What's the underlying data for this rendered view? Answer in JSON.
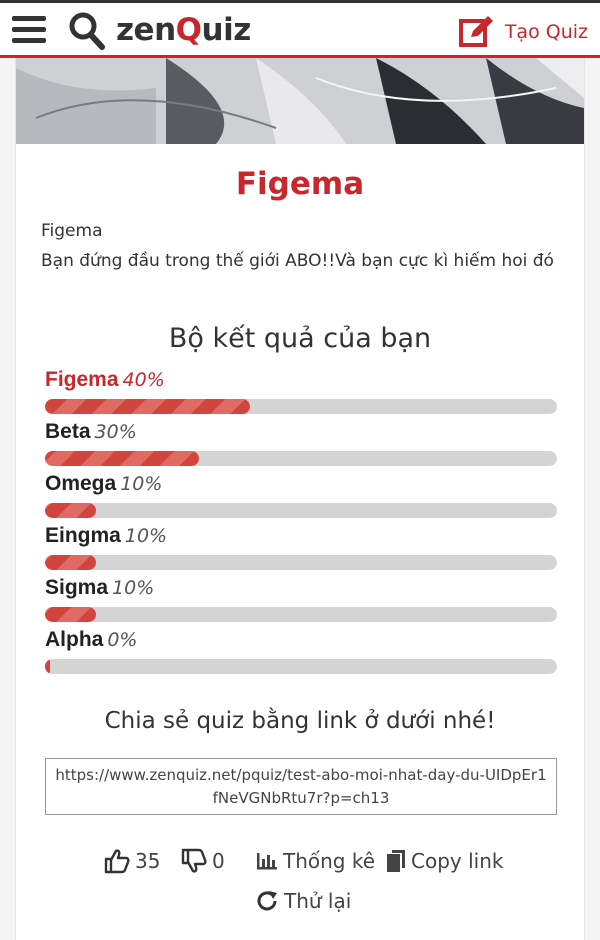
{
  "header": {
    "logo_prefix": "zen",
    "logo_q": "Q",
    "logo_suffix": "uiz",
    "create_quiz_label": "Tạo Quiz"
  },
  "result": {
    "title": "Figema",
    "description_name": "Figema",
    "description_text": "Bạn đứng đầu trong thế giới ABO!!Và bạn cực kì hiếm hoi đó"
  },
  "results_heading": "Bộ kết quả của bạn",
  "results": [
    {
      "name": "Figema",
      "percent_label": "40%",
      "percent": 40
    },
    {
      "name": "Beta",
      "percent_label": "30%",
      "percent": 30
    },
    {
      "name": "Omega",
      "percent_label": "10%",
      "percent": 10
    },
    {
      "name": "Eingma",
      "percent_label": "10%",
      "percent": 10
    },
    {
      "name": "Sigma",
      "percent_label": "10%",
      "percent": 10
    },
    {
      "name": "Alpha",
      "percent_label": "0%",
      "percent": 0
    }
  ],
  "share": {
    "heading": "Chia sẻ quiz bằng link ở dưới nhé!",
    "link": "https://www.zenquiz.net/pquiz/test-abo-moi-nhat-day-du-UIDpEr1fNeVGNbRtu7r?p=ch13"
  },
  "actions": {
    "likes": "35",
    "dislikes": "0",
    "stats_label": "Thống kê",
    "copy_label": "Copy link",
    "retry_label": "Thử lại"
  },
  "colors": {
    "brand": "#c8272e",
    "bar_track": "#d4d4d4",
    "bar_fill": "#d0453e"
  }
}
